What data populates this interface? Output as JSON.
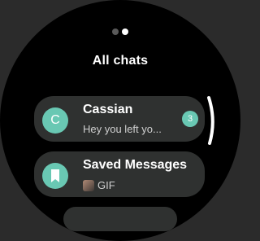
{
  "header": {
    "title": "All chats",
    "page_dots": [
      {
        "active": false
      },
      {
        "active": true
      }
    ]
  },
  "chats": [
    {
      "avatar_letter": "C",
      "name": "Cassian",
      "preview": "Hey you left yo...",
      "unread": "3"
    },
    {
      "avatar_icon": "bookmark-icon",
      "name": "Saved Messages",
      "preview": "GIF"
    }
  ],
  "colors": {
    "accent": "#69c8b3",
    "card_bg": "#2f3130",
    "background": "#000000"
  }
}
